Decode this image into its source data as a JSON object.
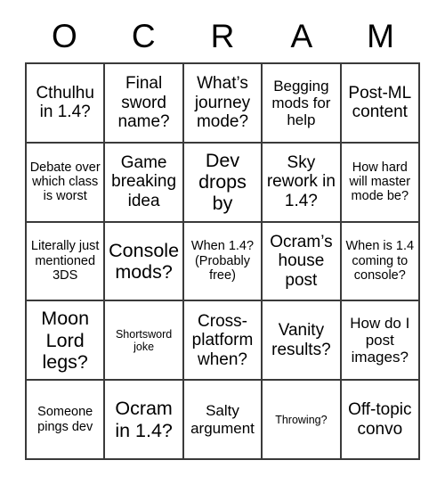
{
  "card": {
    "header_letters": [
      "O",
      "C",
      "R",
      "A",
      "M"
    ],
    "grid": {
      "rows": 5,
      "columns": 5,
      "border_color": "#3a3a3a",
      "background_color": "#ffffff",
      "text_color": "#000000"
    },
    "cells": [
      {
        "text": "Cthulhu in 1.4?",
        "size": "lg"
      },
      {
        "text": "Final sword name?",
        "size": "lg"
      },
      {
        "text": "What’s journey mode?",
        "size": "lg"
      },
      {
        "text": "Begging mods for help",
        "size": "md"
      },
      {
        "text": "Post-ML content",
        "size": "lg"
      },
      {
        "text": "Debate over which class is worst",
        "size": "sm"
      },
      {
        "text": "Game breaking idea",
        "size": "lg"
      },
      {
        "text": "Dev drops by",
        "size": "xl"
      },
      {
        "text": "Sky rework in 1.4?",
        "size": "lg"
      },
      {
        "text": "How hard will master mode be?",
        "size": "sm"
      },
      {
        "text": "Literally just mentioned 3DS",
        "size": "sm"
      },
      {
        "text": "Console mods?",
        "size": "xl"
      },
      {
        "text": "When 1.4? (Probably free)",
        "size": "sm"
      },
      {
        "text": "Ocram’s house post",
        "size": "lg"
      },
      {
        "text": "When is 1.4 coming to console?",
        "size": "sm"
      },
      {
        "text": "Moon Lord legs?",
        "size": "xl"
      },
      {
        "text": "Shortsword joke",
        "size": "xs"
      },
      {
        "text": "Cross-platform when?",
        "size": "lg"
      },
      {
        "text": "Vanity results?",
        "size": "lg"
      },
      {
        "text": "How do I post images?",
        "size": "md"
      },
      {
        "text": "Someone pings dev",
        "size": "sm"
      },
      {
        "text": "Ocram in 1.4?",
        "size": "xl"
      },
      {
        "text": "Salty argument",
        "size": "md"
      },
      {
        "text": "Throwing?",
        "size": "xs"
      },
      {
        "text": "Off-topic convo",
        "size": "lg"
      }
    ]
  }
}
